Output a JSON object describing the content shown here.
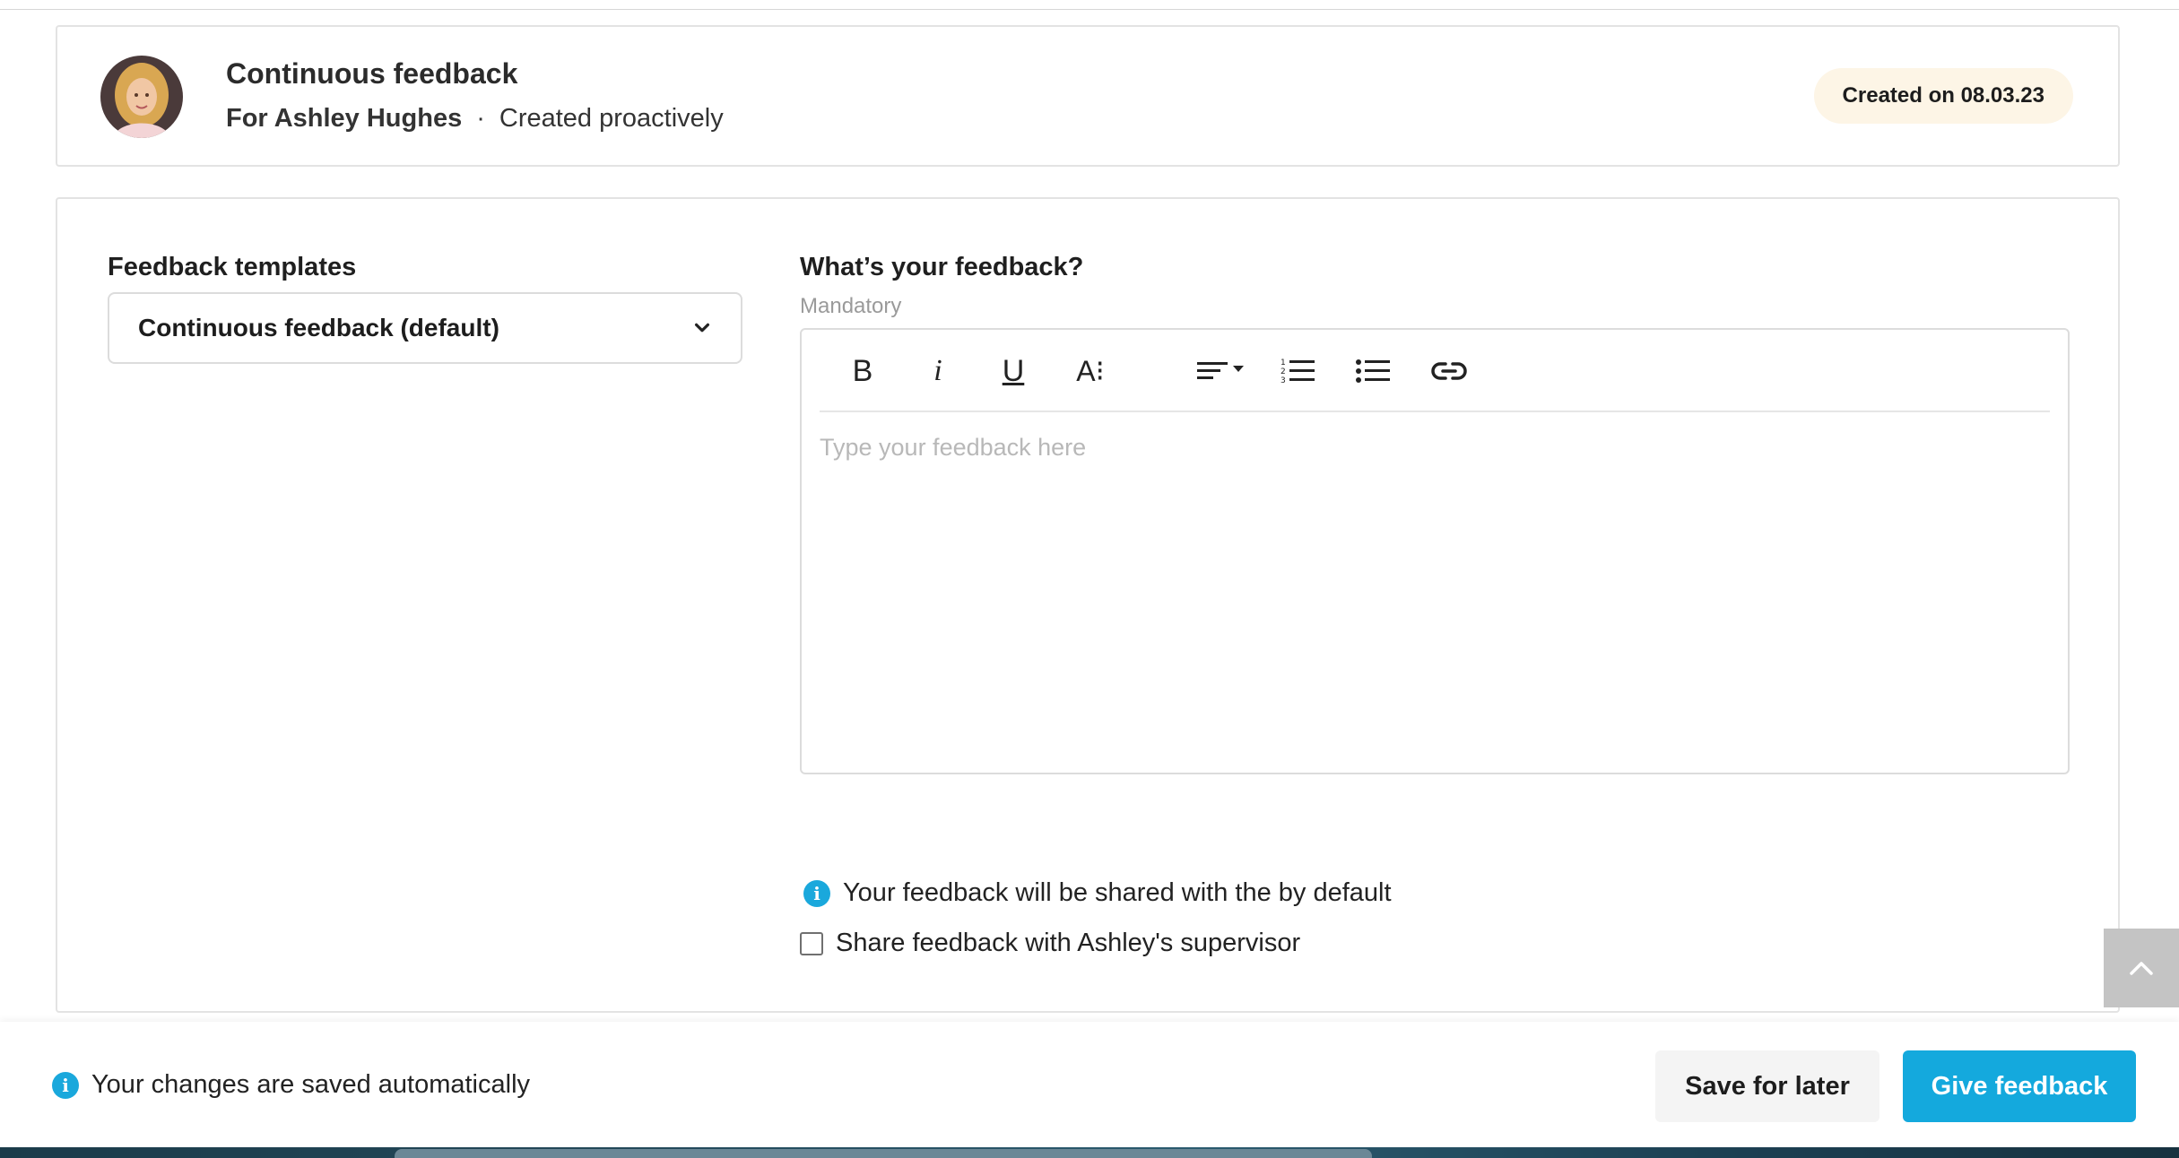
{
  "header": {
    "title": "Continuous feedback",
    "for_label": "For Ashley Hughes",
    "separator": "·",
    "origin": "Created proactively",
    "created_badge": "Created on 08.03.23"
  },
  "templates": {
    "label": "Feedback templates",
    "selected": "Continuous feedback (default)"
  },
  "feedback": {
    "label": "What’s your feedback?",
    "hint": "Mandatory",
    "placeholder": "Type your feedback here",
    "toolbar": {
      "bold": "B",
      "italic": "i",
      "underline": "U",
      "font_size": "A⁝"
    }
  },
  "sharing": {
    "info": "Your feedback will be shared with the by default",
    "checkbox_label": "Share feedback with Ashley's supervisor",
    "checkbox_checked": false
  },
  "footer": {
    "autosave": "Your changes are saved automatically",
    "save_later": "Save for later",
    "give_feedback": "Give feedback"
  },
  "colors": {
    "accent": "#14a9dd",
    "badge_bg": "#fdf5e6"
  }
}
